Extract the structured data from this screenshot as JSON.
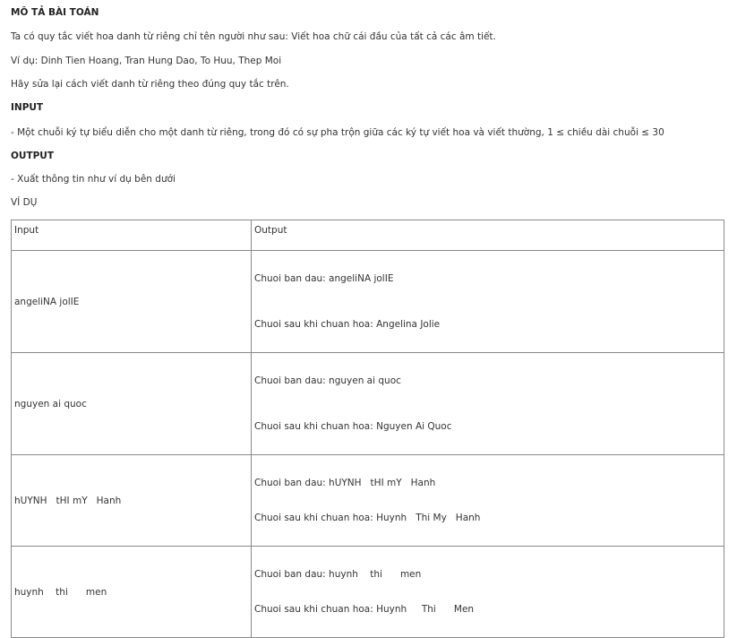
{
  "problem": {
    "title": "MÔ TẢ BÀI TOÁN",
    "rule": "Ta có quy tắc viết hoa danh từ riêng chỉ tên người như sau: Viết hoa chữ cái đầu của tất cả các âm tiết.",
    "example": "Ví dụ: Dinh Tien Hoang, Tran Hung Dao, To Huu, Thep Moi",
    "task": "Hãy sửa lại cách viết danh từ riêng theo đúng quy tắc trên."
  },
  "input_section": {
    "title": "INPUT",
    "text": "- Một chuỗi ký tự biểu diễn cho một danh từ riêng, trong đó có sự pha trộn giữa các ký tự viết hoa và viết thường, 1 ≤ chiều dài chuỗi ≤ 30"
  },
  "output_section": {
    "title": "OUTPUT",
    "text": "- Xuất thông tin như ví dụ bên dưới"
  },
  "examples_title": "VÍ DỤ",
  "table": {
    "header": {
      "input": "Input",
      "output": "Output"
    },
    "rows": [
      {
        "input": "angeliNA jolIE",
        "out1": "Chuoi ban dau: angeliNA jolIE",
        "out2": "Chuoi sau khi chuan hoa: Angelina Jolie"
      },
      {
        "input": "nguyen ai quoc",
        "out1": "Chuoi ban dau: nguyen ai quoc",
        "out2": "Chuoi sau khi chuan hoa: Nguyen Ai Quoc"
      },
      {
        "input": "hUYNH   tHI mY   Hanh",
        "out1": "Chuoi ban dau: hUYNH   tHI mY   Hanh",
        "out2": "Chuoi sau khi chuan hoa: Huynh   Thi My   Hanh"
      },
      {
        "input": "huynh    thi      men",
        "out1": "Chuoi ban dau: huynh    thi      men",
        "out2": "Chuoi sau khi chuan hoa: Huynh     Thi      Men"
      }
    ]
  }
}
